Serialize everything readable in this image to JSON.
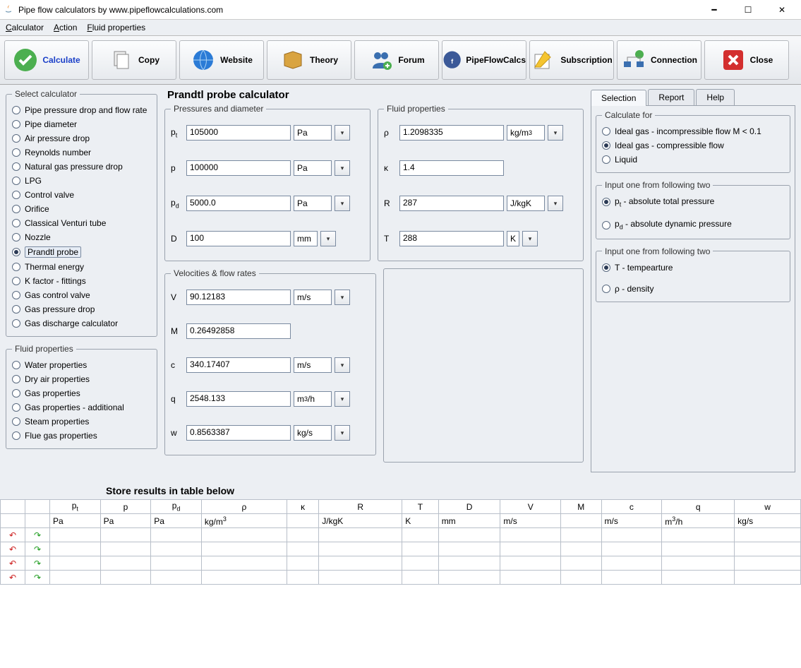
{
  "window": {
    "title": "Pipe flow calculators by www.pipeflowcalculations.com"
  },
  "menu": {
    "calculator": "Calculator",
    "action": "Action",
    "fluid": "Fluid properties"
  },
  "toolbar": {
    "calculate": "Calculate",
    "copy": "Copy",
    "website": "Website",
    "theory": "Theory",
    "forum": "Forum",
    "pfc": "PipeFlowCalcs",
    "subscription": "Subscription",
    "connection": "Connection",
    "close": "Close"
  },
  "sidebar": {
    "select_label": "Select calculator",
    "calculators": [
      "Pipe pressure drop and flow rate",
      "Pipe diameter",
      "Air pressure drop",
      "Reynolds number",
      "Natural gas pressure drop",
      "LPG",
      "Control valve",
      "Orifice",
      "Classical Venturi tube",
      "Nozzle",
      "Prandtl probe",
      "Thermal energy",
      "K factor - fittings",
      "Gas control valve",
      "Gas pressure drop",
      "Gas discharge calculator"
    ],
    "selected_calculator": "Prandtl probe",
    "fluid_label": "Fluid properties",
    "fluids": [
      "Water properties",
      "Dry air properties",
      "Gas properties",
      "Gas properties - additional",
      "Steam properties",
      "Flue gas properties"
    ]
  },
  "page": {
    "title": "Prandtl probe calculator"
  },
  "pressures": {
    "legend": "Pressures and diameter",
    "pt": {
      "sym": "p",
      "sub": "t",
      "val": "105000",
      "unit": "Pa"
    },
    "p": {
      "sym": "p",
      "val": "100000",
      "unit": "Pa"
    },
    "pd": {
      "sym": "p",
      "sub": "d",
      "val": "5000.0",
      "unit": "Pa"
    },
    "D": {
      "sym": "D",
      "val": "100",
      "unit": "mm"
    }
  },
  "velocities": {
    "legend": "Velocities & flow rates",
    "V": {
      "sym": "V",
      "val": "90.12183",
      "unit": "m/s"
    },
    "M": {
      "sym": "M",
      "val": "0.26492858"
    },
    "c": {
      "sym": "c",
      "val": "340.17407",
      "unit": "m/s"
    },
    "q": {
      "sym": "q",
      "val": "2548.133",
      "unit_html": "m³/h"
    },
    "w": {
      "sym": "w",
      "val": "0.8563387",
      "unit": "kg/s"
    }
  },
  "fluid_props": {
    "legend": "Fluid properties",
    "rho": {
      "sym": "ρ",
      "val": "1.2098335",
      "unit_html": "kg/m³"
    },
    "kappa": {
      "sym": "κ",
      "val": "1.4"
    },
    "R": {
      "sym": "R",
      "val": "287",
      "unit": "J/kgK"
    },
    "T": {
      "sym": "T",
      "val": "288",
      "unit": "K"
    }
  },
  "tabs": {
    "selection": "Selection",
    "report": "Report",
    "help": "Help"
  },
  "selection": {
    "calc_for": "Calculate for",
    "opt1": "Ideal gas - incompressible flow M < 0.1",
    "opt2": "Ideal gas - compressible flow",
    "opt3": "Liquid",
    "inputA": "Input one from following two",
    "a1": "pₜ - absolute total pressure",
    "a2": "p_d - absolute dynamic pressure",
    "inputB": "Input one from following two",
    "b1": "T - tempearture",
    "b2": "ρ - density"
  },
  "store": {
    "title": "Store results in table below"
  },
  "table": {
    "headers": [
      "",
      "",
      "pₜ",
      "p",
      "p_d",
      "ρ",
      "κ",
      "R",
      "T",
      "D",
      "V",
      "M",
      "c",
      "q",
      "w"
    ],
    "units": [
      "",
      "",
      "Pa",
      "Pa",
      "Pa",
      "kg/m³",
      "",
      "J/kgK",
      "K",
      "mm",
      "m/s",
      "",
      "m/s",
      "m³/h",
      "kg/s"
    ],
    "rows": 4
  }
}
